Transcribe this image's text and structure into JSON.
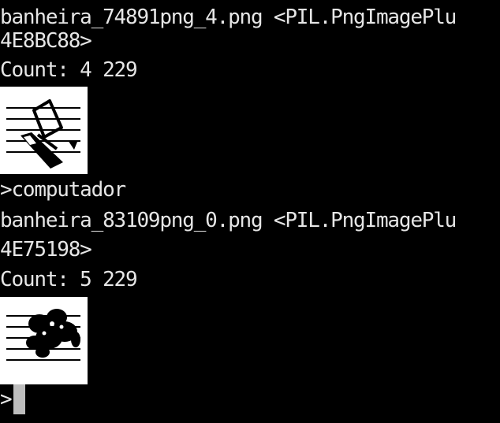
{
  "output": {
    "entry1": {
      "filename_line": "banheira_74891png_4.png <PIL.PngImagePlu",
      "address_line": "4E8BC88>",
      "count_line": "Count: 4 229",
      "thumbnail_icon": "drawing-on-staff-icon"
    },
    "answer1": ">computador",
    "entry2": {
      "filename_line": "banheira_83109png_0.png <PIL.PngImagePlu",
      "address_line": "4E75198>",
      "count_line": "Count: 5 229",
      "thumbnail_icon": "drawing-on-staff-icon"
    }
  },
  "prompt": {
    "symbol": ">"
  },
  "colors": {
    "background": "#000000",
    "text": "#e6e6e6",
    "cursor": "#bdbdbd",
    "thumbnail_background": "#ffffff"
  }
}
